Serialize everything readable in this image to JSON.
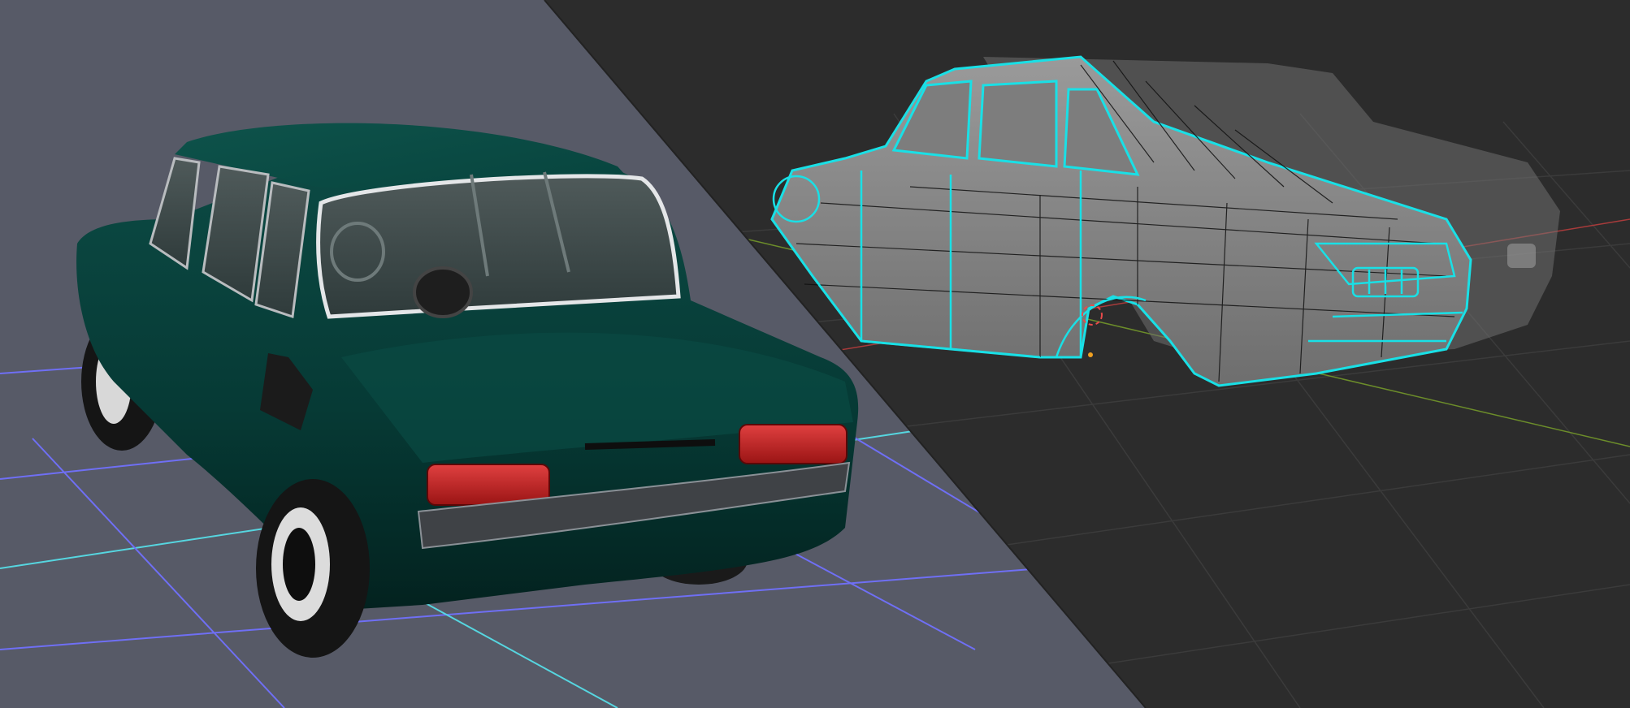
{
  "colors": {
    "render_background": "#575a67",
    "editor_background": "#2c2c2c",
    "car_body": "#073d38",
    "car_body_dark": "#04231f",
    "taillight": "#c41e1e",
    "wireframe_selected": "#19e0e6",
    "mesh_surface": "#8a8a8a",
    "grid_blue": "#6f6ff5",
    "grid_cyan": "#56d6e0",
    "axis_red": "#a83b3b",
    "axis_green": "#6c8d2a"
  },
  "icons": {
    "object_origin": "origin-dot-icon",
    "3d_cursor": "3d-cursor-icon"
  }
}
